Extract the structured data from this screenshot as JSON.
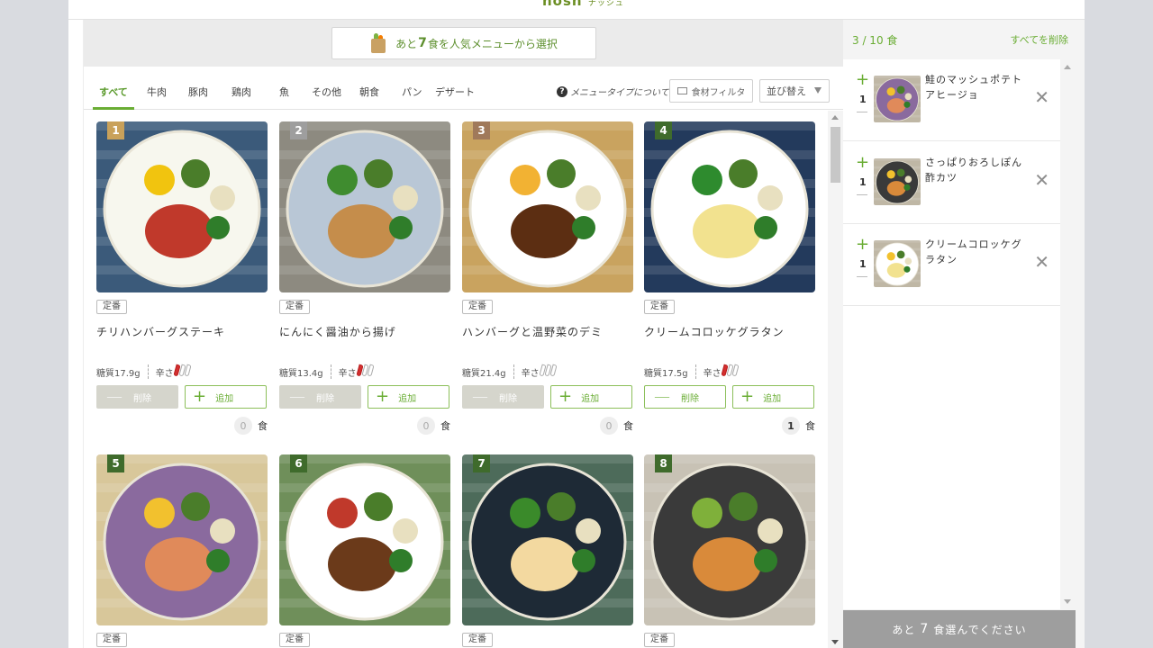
{
  "logo": {
    "text": "nosh",
    "sub": "ナッシュ"
  },
  "banner": {
    "prefix": "あと",
    "number": "7",
    "suffix": "食を人気メニューから選択",
    "icon": "shopping-bag-icon"
  },
  "tabs": [
    {
      "label": "すべて",
      "active": true
    },
    {
      "label": "牛肉"
    },
    {
      "label": "豚肉"
    },
    {
      "label": "鶏肉"
    },
    {
      "label": "魚"
    },
    {
      "label": "その他"
    },
    {
      "label": "朝食"
    },
    {
      "label": "パン"
    },
    {
      "label": "デザート"
    }
  ],
  "toolbar": {
    "help": "メニュータイプについて",
    "filter": "食材フィルタ",
    "sort": "並び替え"
  },
  "cards": [
    {
      "num": "1",
      "badge_color": "#c9a15a",
      "tag": "定番",
      "name": "チリハンバーグステーキ",
      "carb": "糖質17.9g",
      "spice_label": "辛さ",
      "spice": 1,
      "del": "削除",
      "add": "追加",
      "qty": "0",
      "unit": "食",
      "bg": "#3b5a7a",
      "plate": "#f7f7ee",
      "main": "#c0392b",
      "accent": "#f1c40f"
    },
    {
      "num": "2",
      "badge_color": "#9e9e9e",
      "tag": "定番",
      "name": "にんにく醤油から揚げ",
      "carb": "糖質13.4g",
      "spice_label": "辛さ",
      "spice": 1,
      "del": "削除",
      "add": "追加",
      "qty": "0",
      "unit": "食",
      "bg": "#8d8a80",
      "plate": "#b9c7d6",
      "main": "#c58d4b",
      "accent": "#3f8c2f"
    },
    {
      "num": "3",
      "badge_color": "#a0795a",
      "tag": "定番",
      "name": "ハンバーグと温野菜のデミ",
      "carb": "糖質21.4g",
      "spice_label": "辛さ",
      "spice": 0,
      "del": "削除",
      "add": "追加",
      "qty": "0",
      "unit": "食",
      "bg": "#c9a35f",
      "plate": "#ffffff",
      "main": "#5c2e12",
      "accent": "#f2b233"
    },
    {
      "num": "4",
      "badge_color": "#3f6b2c",
      "tag": "定番",
      "name": "クリームコロッケグラタン",
      "carb": "糖質17.5g",
      "spice_label": "辛さ",
      "spice": 1,
      "del": "削除",
      "add": "追加",
      "qty": "1",
      "unit": "食",
      "bg": "#233a5c",
      "plate": "#ffffff",
      "main": "#f2e28f",
      "accent": "#2e8b2e"
    },
    {
      "num": "5",
      "badge_color": "#3f6b2c",
      "tag": "定番",
      "bg": "#d8c79a",
      "plate": "#8a6a9e",
      "main": "#e08a5a",
      "accent": "#f2c12e"
    },
    {
      "num": "6",
      "badge_color": "#3f6b2c",
      "tag": "定番",
      "bg": "#6f8f5a",
      "plate": "#ffffff",
      "main": "#6b3a1a",
      "accent": "#c0392b"
    },
    {
      "num": "7",
      "badge_color": "#3f6b2c",
      "tag": "定番",
      "bg": "#4d6b5a",
      "plate": "#1e2a36",
      "main": "#f3d9a0",
      "accent": "#3a8a2a"
    },
    {
      "num": "8",
      "badge_color": "#3f6b2c",
      "tag": "定番",
      "bg": "#c8c2b5",
      "plate": "#3a3a3a",
      "main": "#d98a3a",
      "accent": "#7fb03a"
    }
  ],
  "sidebar": {
    "count": "3 / 10 食",
    "clear": "すべてを削除",
    "items": [
      {
        "qty": "1",
        "name": "鮭のマッシュポテトアヒージョ",
        "plate": "#8a6a9e",
        "main": "#e08a5a"
      },
      {
        "qty": "1",
        "name": "さっぱりおろしぽん酢カツ",
        "plate": "#3a3a3a",
        "main": "#d98a3a"
      },
      {
        "qty": "1",
        "name": "クリームコロッケグラタン",
        "plate": "#ffffff",
        "main": "#f2e28f"
      }
    ],
    "footer_prefix": "あと",
    "footer_num": "7",
    "footer_suffix": "食選んでください"
  }
}
